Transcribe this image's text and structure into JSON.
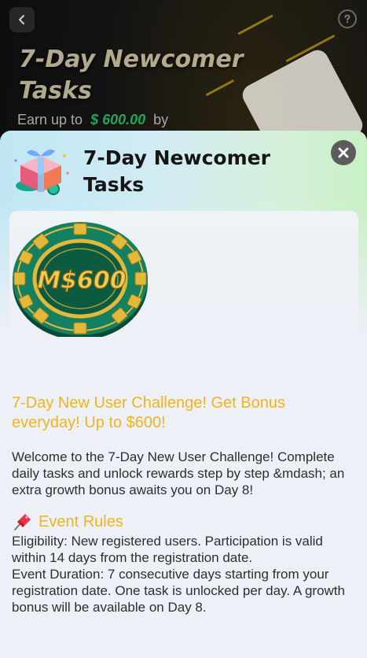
{
  "background": {
    "title": "7-Day Newcomer Tasks",
    "earn_prefix": "Earn up to",
    "earn_amount": "$ 600.00",
    "earn_suffix": "by",
    "back_icon": "chevron-left-icon",
    "help_icon": "question-circle-icon"
  },
  "sheet": {
    "title": "7-Day Newcomer Tasks",
    "header_icon": "gift-box-icon",
    "close_icon": "close-icon",
    "chip_label": "M$600",
    "headline": "7-Day New User Challenge! Get Bonus everyday! Up to $600!",
    "intro": "Welcome to the 7-Day New User Challenge! Complete daily tasks and unlock rewards step by step &mdash; an extra growth bonus awaits you on Day 8!",
    "rules_title": "Event Rules",
    "rules_icon": "pushpin-icon",
    "rules": [
      "Eligibility: New registered users. Participation is valid within 14 days from the registration date.",
      "Event Duration: 7 consecutive days starting from your registration date. One task is unlocked per day. A growth bonus will be available on Day 8."
    ]
  },
  "colors": {
    "accent": "#f0b41c",
    "earn_green": "#1fa85a",
    "chip_green": "#0f6a48",
    "chip_gold": "#e2b93b",
    "sheet_bg": "#edf0f7"
  }
}
